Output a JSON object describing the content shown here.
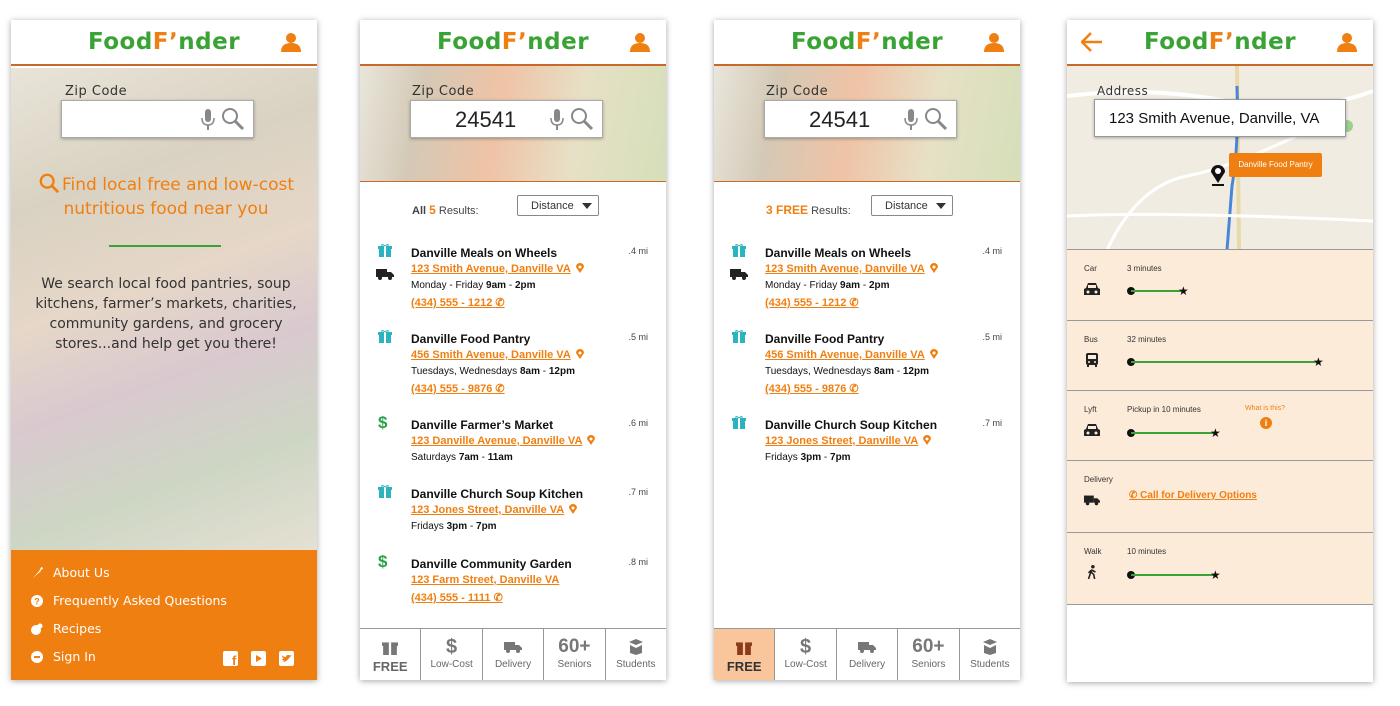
{
  "brand": {
    "food": "Food",
    "finder": "F",
    "finder_rest": "nder",
    "green": "#3aa335",
    "orange": "#f07f11"
  },
  "screen1": {
    "zip_label": "Zip Code",
    "tagline": "Find local free and low-cost nutritious food near you",
    "blurb": "We search local food pantries, soup kitchens, farmer’s markets, charities, community gardens, and grocery stores...and help get you there!",
    "menu": [
      {
        "label": "About Us",
        "icon": "carrot-icon"
      },
      {
        "label": "Frequently Asked Questions",
        "icon": "question-icon"
      },
      {
        "label": "Recipes",
        "icon": "recipes-icon"
      },
      {
        "label": "Sign In",
        "icon": "signin-icon"
      }
    ]
  },
  "search": {
    "zip_label": "Zip Code",
    "zip_value": "24541"
  },
  "screen2": {
    "count_prefix": "All",
    "count": "5",
    "count_suffix": "Results:",
    "sort": "Distance",
    "results": [
      {
        "name": "Danville Meals on Wheels",
        "dist": ".4 mi",
        "address": "123 Smith Avenue, Danville VA",
        "hours_a": "Monday - Friday ",
        "hours_b": "9am",
        "hours_c": " - ",
        "hours_d": "2pm",
        "phone": "(434) 555 - 1212",
        "icon": "gift-icon"
      },
      {
        "name": "Danville Food Pantry",
        "dist": ".5 mi",
        "address": "456 Smith Avenue, Danville VA",
        "hours_a": "Tuesdays, Wednesdays ",
        "hours_b": "8am",
        "hours_c": " - ",
        "hours_d": "12pm",
        "phone": "(434) 555 - 9876",
        "icon": "gift-icon"
      },
      {
        "name": "Danville Farmer’s Market",
        "dist": ".6 mi",
        "address": "123 Danville Avenue, Danville VA",
        "hours_a": "Saturdays ",
        "hours_b": "7am",
        "hours_c": " - ",
        "hours_d": "11am",
        "phone": "",
        "icon": "dollar-icon"
      },
      {
        "name": "Danville Church Soup Kitchen",
        "dist": ".7 mi",
        "address": "123 Jones Street, Danville VA",
        "hours_a": "Fridays ",
        "hours_b": "3pm",
        "hours_c": " - ",
        "hours_d": "7pm",
        "phone": "",
        "icon": "gift-icon"
      },
      {
        "name": "Danville Community Garden",
        "dist": ".8 mi",
        "address": "123 Farm Street, Danville VA",
        "hours_a": "",
        "hours_b": "",
        "hours_c": "",
        "hours_d": "",
        "phone": "(434) 555 - 1111",
        "icon": "dollar-icon"
      }
    ]
  },
  "screen3": {
    "count": "3 FREE",
    "count_suffix": "Results:",
    "sort": "Distance"
  },
  "tabs": [
    {
      "label": "FREE",
      "icon": "gift-icon"
    },
    {
      "label": "Low-Cost",
      "icon": "dollar-icon"
    },
    {
      "label": "Delivery",
      "icon": "truck-icon"
    },
    {
      "label": "Seniors",
      "big": "60+"
    },
    {
      "label": "Students",
      "icon": "book-icon"
    }
  ],
  "screen4": {
    "address_label": "Address",
    "address": "123 Smith Avenue, Danville, VA",
    "map_tag": "Danville Food Pantry",
    "modes": [
      {
        "label": "Car",
        "time": "3 minutes",
        "level": 0.28
      },
      {
        "label": "Bus",
        "time": "32 minutes",
        "level": 1.0
      },
      {
        "label": "Lyft",
        "time": "Pickup in 10 minutes",
        "level": 0.45,
        "help": "What is this?"
      },
      {
        "label": "Delivery",
        "call": "Call for Delivery Options"
      },
      {
        "label": "Walk",
        "time": "10 minutes",
        "level": 0.45
      }
    ]
  }
}
